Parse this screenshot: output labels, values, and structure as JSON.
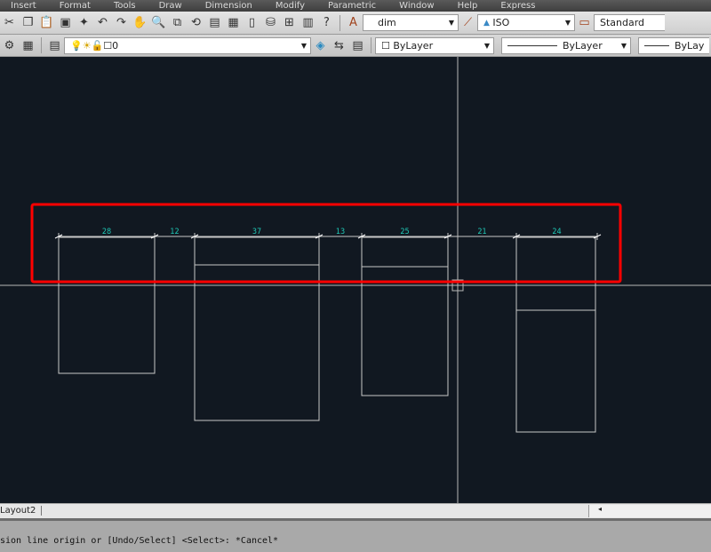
{
  "menu": [
    "Insert",
    "Format",
    "Tools",
    "Draw",
    "Dimension",
    "Modify",
    "Parametric",
    "Window",
    "Help",
    "Express"
  ],
  "toolbar1": {
    "icons": [
      "cut-icon",
      "copy-icon",
      "paste-icon",
      "match-properties-icon",
      "block-editor-icon",
      "undo-icon",
      "redo-icon",
      "pan-icon",
      "zoom-realtime-icon",
      "zoom-window-icon",
      "zoom-previous-icon",
      "properties-icon",
      "design-center-icon",
      "tool-palettes-icon",
      "sheet-set-icon",
      "markup-icon",
      "calculator-icon",
      "help-icon"
    ],
    "text_style": "dim",
    "dim_style": "ISO",
    "table_style": "Standard"
  },
  "toolbar2": {
    "layer": "0",
    "color": "ByLayer",
    "linetype": "ByLayer",
    "lineweight": "ByLay"
  },
  "drawing": {
    "highlight_color": "#ff0000",
    "dim_text_color": "#1fc7b5",
    "line_color": "#c8c8c8",
    "dimensions": [
      "28",
      "12",
      "37",
      "13",
      "25",
      "21",
      "24"
    ]
  },
  "tabs": {
    "layout": "Layout2"
  },
  "command": {
    "line": "sion line origin or [Undo/Select] <Select>: *Cancel*"
  }
}
